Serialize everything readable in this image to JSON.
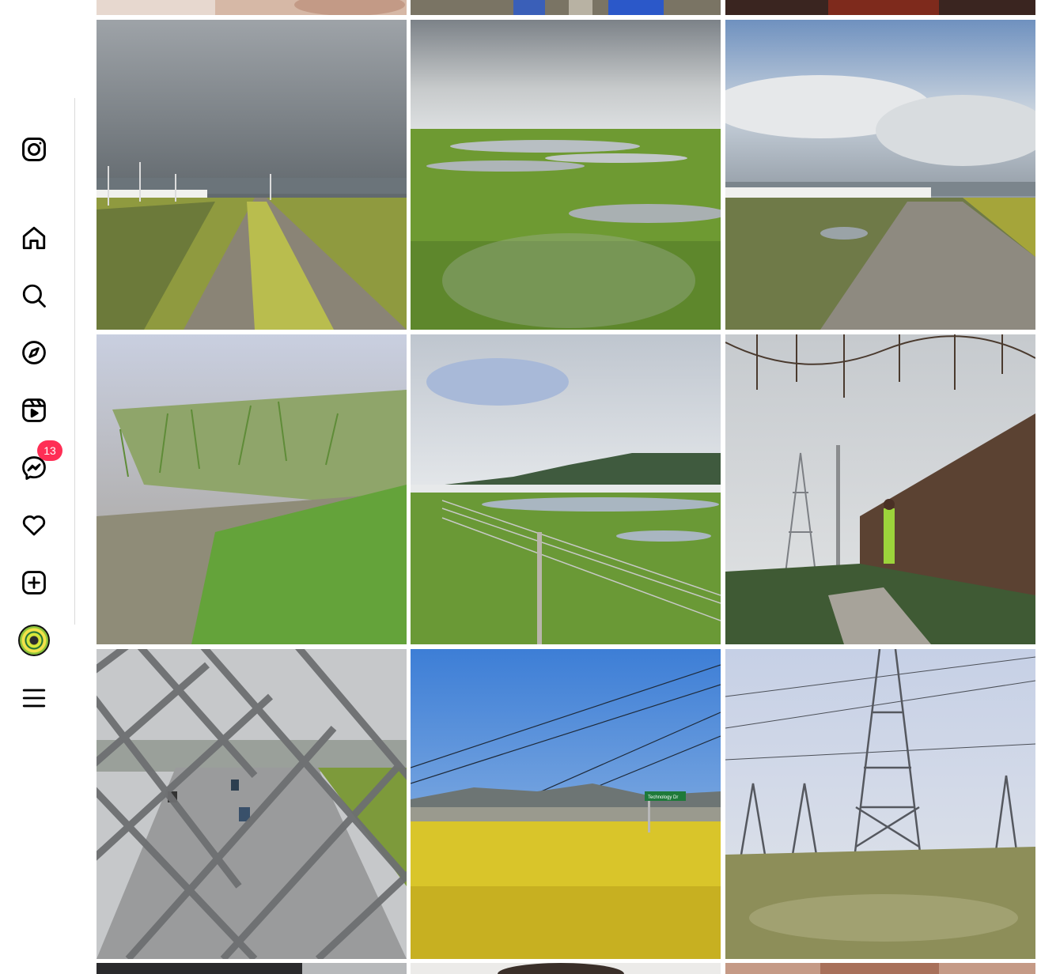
{
  "app": {
    "name": "Instagram"
  },
  "sidebar": {
    "items": [
      {
        "id": "logo",
        "icon": "instagram-logo-icon"
      },
      {
        "id": "home",
        "icon": "home-icon"
      },
      {
        "id": "search",
        "icon": "search-icon"
      },
      {
        "id": "explore",
        "icon": "compass-icon"
      },
      {
        "id": "reels",
        "icon": "reels-icon"
      },
      {
        "id": "messages",
        "icon": "messenger-icon",
        "badge": "13"
      },
      {
        "id": "notifications",
        "icon": "heart-icon"
      },
      {
        "id": "create",
        "icon": "plus-square-icon"
      },
      {
        "id": "profile",
        "icon": "avatar"
      },
      {
        "id": "more",
        "icon": "hamburger-menu-icon"
      }
    ]
  },
  "colors": {
    "badge": "#ff2e55",
    "icon": "#000000",
    "divider": "#dbdbdb"
  },
  "grid": {
    "rows": [
      {
        "row": "partial-top",
        "tiles": [
          "photo-face-closeup",
          "photo-blue-objects",
          "photo-red-dark"
        ]
      },
      {
        "row": 1,
        "tiles": [
          "photo-dirt-road-power-lines",
          "photo-wetland-puddles",
          "photo-warehouse-gravel-road"
        ]
      },
      {
        "row": 2,
        "tiles": [
          "photo-marsh-grass",
          "photo-wetland-fence-mountains",
          "photo-hiker-power-tower"
        ]
      },
      {
        "row": 3,
        "tiles": [
          "photo-freeway-chain-fence",
          "photo-yellow-flowers-sign",
          "photo-transmission-towers"
        ]
      },
      {
        "row": "partial-bottom",
        "tiles": [
          "photo-dark-interior",
          "photo-person-hair",
          "photo-reddish-surface"
        ]
      }
    ],
    "signs": {
      "street_sign": "Technology Dr"
    }
  }
}
